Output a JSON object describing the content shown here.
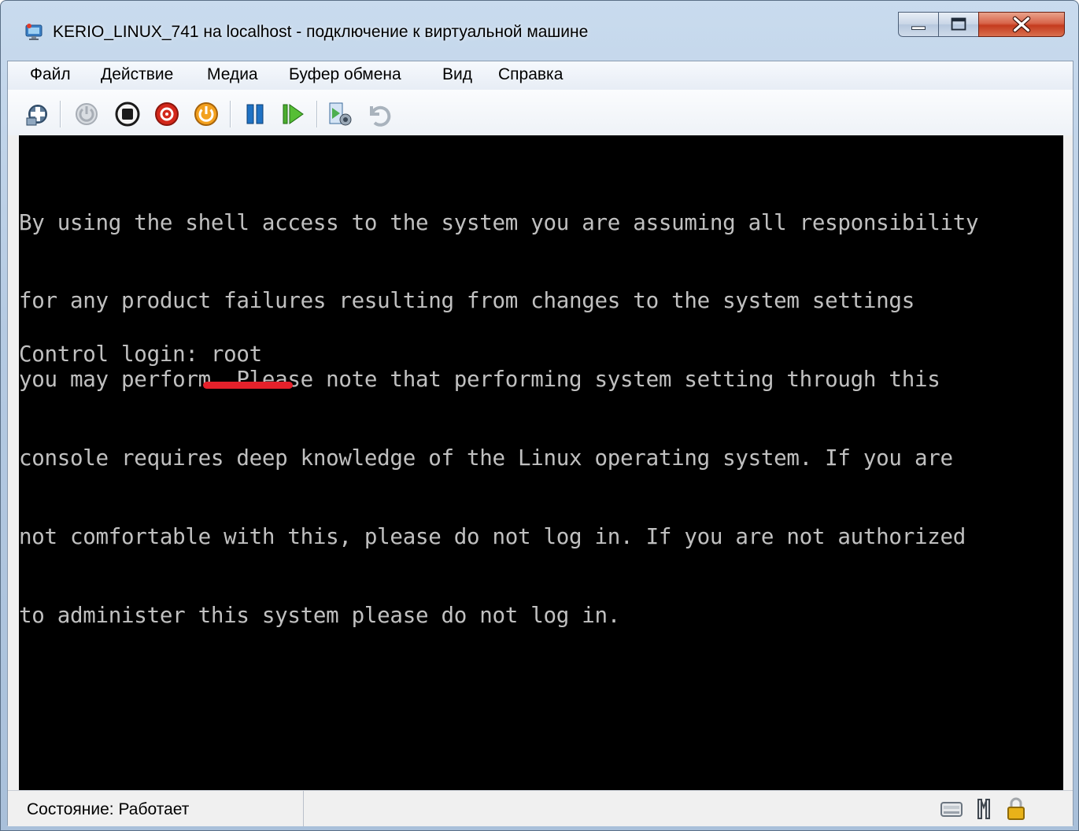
{
  "window": {
    "title": "KERIO_LINUX_741 на localhost - подключение к виртуальной машине",
    "controls": [
      "minimize-icon",
      "maximize-icon",
      "close-icon"
    ]
  },
  "menubar": {
    "items": [
      "Файл",
      "Действие",
      "Медиа",
      "Буфер обмена",
      "Вид",
      "Справка"
    ]
  },
  "toolbar": {
    "buttons": [
      {
        "name": "ctrl-alt-del-icon"
      },
      {
        "name": "start-icon",
        "state": "disabled"
      },
      {
        "name": "turn-off-icon"
      },
      {
        "name": "shut-down-icon"
      },
      {
        "name": "save-state-icon"
      },
      {
        "name": "pause-icon"
      },
      {
        "name": "resume-icon"
      },
      {
        "name": "snapshot-icon"
      },
      {
        "name": "revert-icon"
      }
    ]
  },
  "console": {
    "lines": [
      "By using the shell access to the system you are assuming all responsibility",
      "for any product failures resulting from changes to the system settings",
      "you may perform. Please note that performing system setting through this",
      "console requires deep knowledge of the Linux operating system. If you are",
      "not comfortable with this, please do not log in. If you are not authorized",
      "to administer this system please do not log in."
    ],
    "prompt": "Control login: root",
    "highlight_color": "#e5212b"
  },
  "statusbar": {
    "status": "Состояние: Работает",
    "icons": [
      "keyboard-icon",
      "mouse-icon",
      "lock-icon"
    ]
  }
}
